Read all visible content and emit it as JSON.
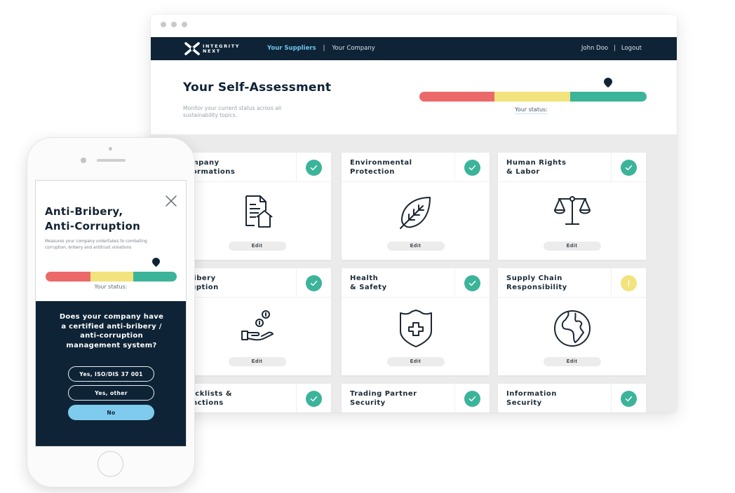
{
  "brand": {
    "logo_line1": "INTEGRITY",
    "logo_line2": "NEXT",
    "primary_color": "#0e2336",
    "accent_color": "#6fc4ea"
  },
  "nav": {
    "links": [
      {
        "label": "Your Suppliers",
        "active": true
      },
      {
        "label": "Your Company",
        "active": false
      }
    ],
    "separator": "|",
    "user_name": "John Doo",
    "logout_label": "Logout"
  },
  "header": {
    "title": "Your Self-Assessment",
    "subtitle": "Monitor your current status across all sustainability topics.",
    "status_label": "Your status:",
    "status_scale": {
      "segments": [
        {
          "name": "red",
          "color": "#ec6969"
        },
        {
          "name": "yellow",
          "color": "#f2e37c"
        },
        {
          "name": "green",
          "color": "#3bb49a"
        }
      ],
      "marker_value_percent": 83
    }
  },
  "cards": [
    {
      "title": "Company\nInformations",
      "status": "complete",
      "icon": "document-house-icon",
      "edit_label": "Edit"
    },
    {
      "title": "Environmental\nProtection",
      "status": "complete",
      "icon": "leaf-icon",
      "edit_label": "Edit"
    },
    {
      "title": "Human Rights\n& Labor",
      "status": "complete",
      "icon": "scales-icon",
      "edit_label": "Edit"
    },
    {
      "title": "Anti-Bribery\n& Corruption",
      "status": "complete",
      "icon": "hand-coins-icon",
      "edit_label": "Edit"
    },
    {
      "title": "Health\n& Safety",
      "status": "complete",
      "icon": "shield-cross-icon",
      "edit_label": "Edit"
    },
    {
      "title": "Supply Chain\nResponsibility",
      "status": "warning",
      "icon": "globe-icon",
      "edit_label": "Edit"
    },
    {
      "title": "Blacklists &\nSanctions",
      "status": "complete",
      "icon": "",
      "edit_label": ""
    },
    {
      "title": "Trading Partner\nSecurity",
      "status": "complete",
      "icon": "",
      "edit_label": ""
    },
    {
      "title": "Information\nSecurity",
      "status": "complete",
      "icon": "",
      "edit_label": ""
    }
  ],
  "status_colors": {
    "complete": "#3bb49a",
    "warning": "#f2e37c"
  },
  "mobile": {
    "modal_title": "Anti-Bribery,\nAnti-Corruption",
    "modal_description": "Measures your company undertakes to combating corruption, bribery and antitrust violations",
    "status_label": "Your status:",
    "marker_value_percent": 84,
    "question": "Does your company have\na certified anti-bribery /\nanti-corruption\nmanagement system?",
    "answers": [
      {
        "label": "Yes, ISO/DIS 37 001",
        "selected": false
      },
      {
        "label": "Yes, other",
        "selected": false
      },
      {
        "label": "No",
        "selected": true
      }
    ]
  }
}
